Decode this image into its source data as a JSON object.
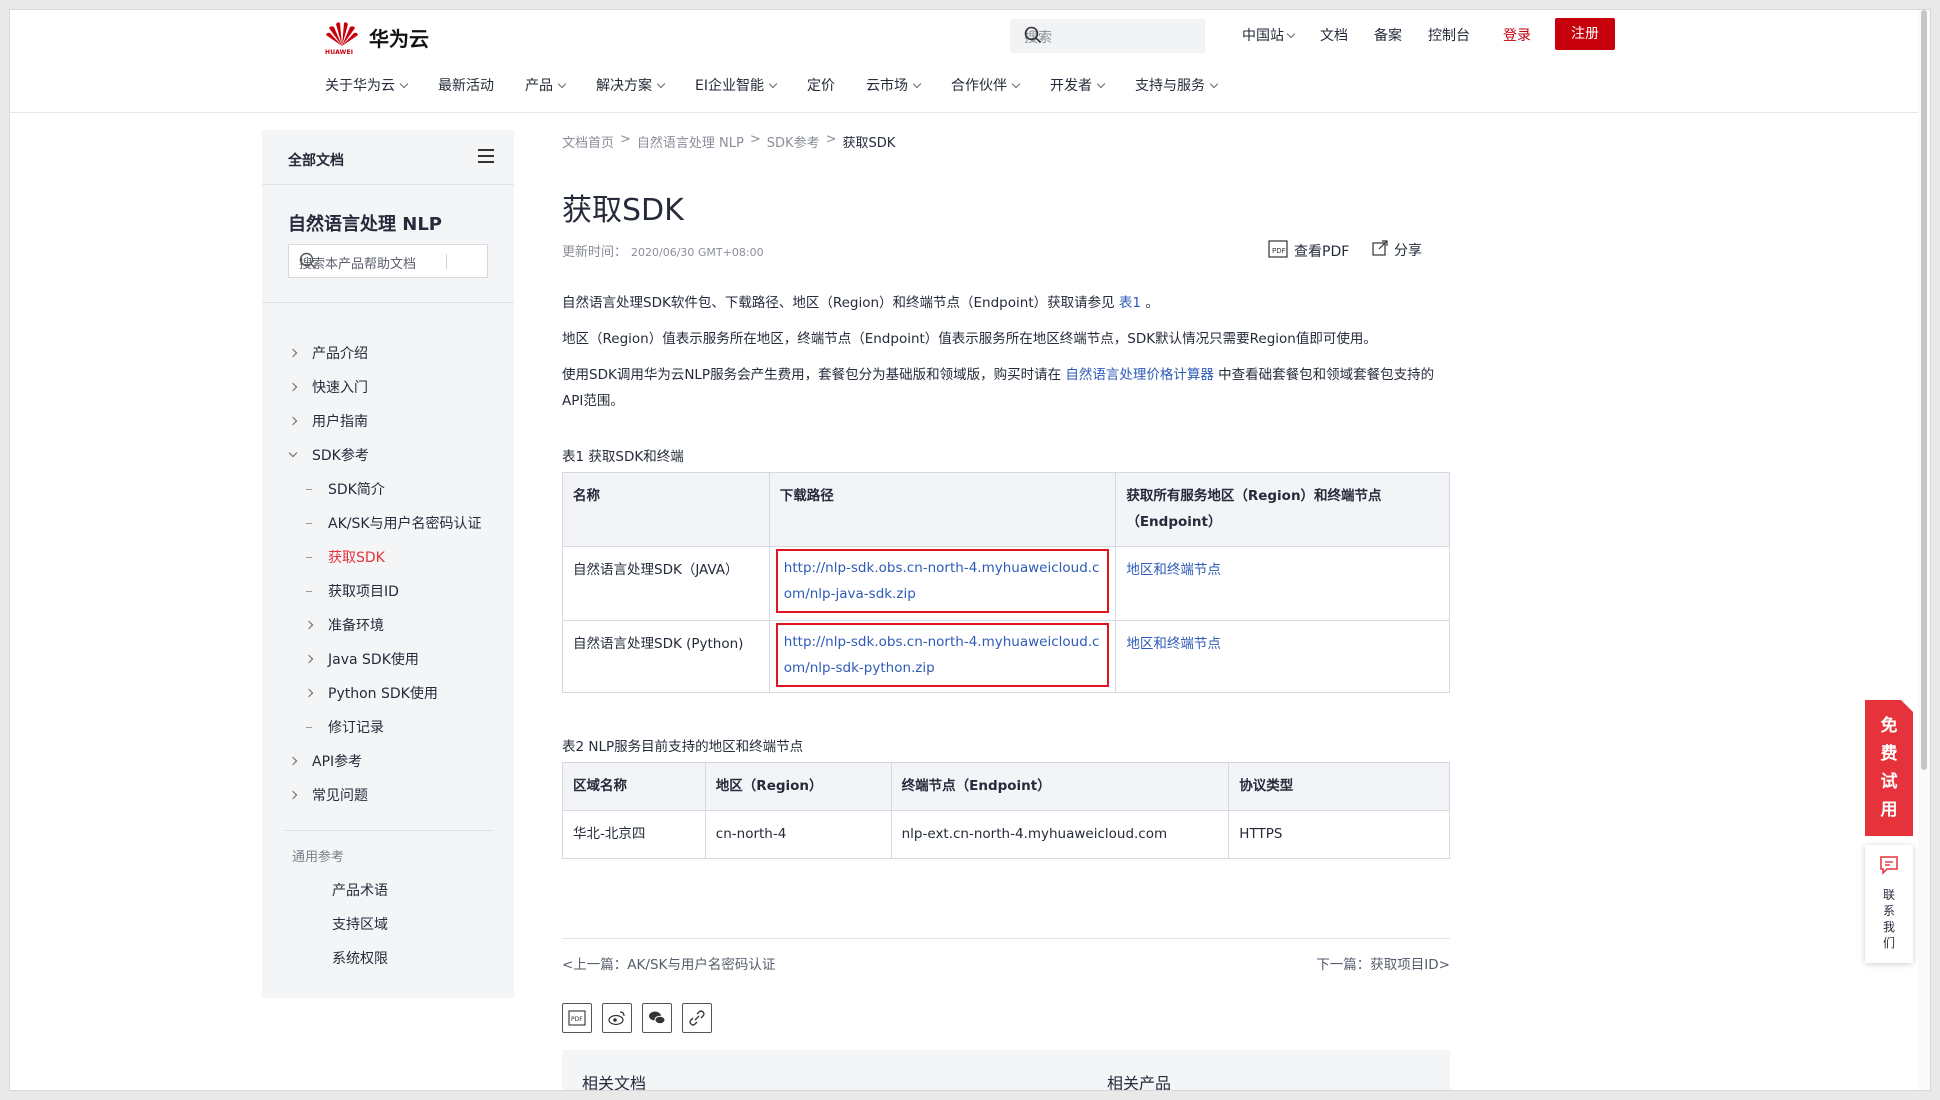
{
  "header": {
    "logo_small": "HUAWEI",
    "logo_text": "华为云",
    "search_placeholder": "搜索",
    "top_links": [
      "中国站",
      "文档",
      "备案",
      "控制台"
    ],
    "login": "登录",
    "register": "注册",
    "main_nav": [
      "关于华为云",
      "最新活动",
      "产品",
      "解决方案",
      "EI企业智能",
      "定价",
      "云市场",
      "合作伙伴",
      "开发者",
      "支持与服务"
    ]
  },
  "sidebar": {
    "all_docs": "全部文档",
    "product": "自然语言处理 NLP",
    "search_placeholder": "搜索本产品帮助文档",
    "tree": [
      {
        "label": "产品介绍",
        "level": 0,
        "marker": "right"
      },
      {
        "label": "快速入门",
        "level": 0,
        "marker": "right"
      },
      {
        "label": "用户指南",
        "level": 0,
        "marker": "right"
      },
      {
        "label": "SDK参考",
        "level": 0,
        "marker": "down"
      },
      {
        "label": "SDK简介",
        "level": 1,
        "marker": "dash"
      },
      {
        "label": "AK/SK与用户名密码认证",
        "level": 1,
        "marker": "dash"
      },
      {
        "label": "获取SDK",
        "level": 1,
        "marker": "dash",
        "active": true
      },
      {
        "label": "获取项目ID",
        "level": 1,
        "marker": "dash"
      },
      {
        "label": "准备环境",
        "level": 1,
        "marker": "right"
      },
      {
        "label": "Java SDK使用",
        "level": 1,
        "marker": "right"
      },
      {
        "label": "Python SDK使用",
        "level": 1,
        "marker": "right"
      },
      {
        "label": "修订记录",
        "level": 1,
        "marker": "dash"
      },
      {
        "label": "API参考",
        "level": 0,
        "marker": "right"
      },
      {
        "label": "常见问题",
        "level": 0,
        "marker": "right"
      }
    ],
    "common_ref": "通用参考",
    "common_items": [
      "产品术语",
      "支持区域",
      "系统权限"
    ]
  },
  "breadcrumb": [
    "文档首页",
    "自然语言处理 NLP",
    "SDK参考",
    "获取SDK"
  ],
  "page": {
    "title": "获取SDK",
    "updated_label": "更新时间：",
    "updated_value": "2020/06/30 GMT+08:00",
    "pdf": "查看PDF",
    "share": "分享",
    "p1_a": "自然语言处理SDK软件包、下载路径、地区（Region）和终端节点（Endpoint）获取请参见",
    "p1_link": "表1",
    "p1_b": "。",
    "p2": "地区（Region）值表示服务所在地区，终端节点（Endpoint）值表示服务所在地区终端节点，SDK默认情况只需要Region值即可使用。",
    "p3_a": "使用SDK调用华为云NLP服务会产生费用，套餐包分为基础版和领域版，购买时请在",
    "p3_link": "自然语言处理价格计算器",
    "p3_b": "中查看础套餐包和领域套餐包支持的API范围。"
  },
  "table1": {
    "caption": "表1 获取SDK和终端",
    "headers": [
      "名称",
      "下载路径",
      "获取所有服务地区（Region）和终端节点（Endpoint）"
    ],
    "rows": [
      [
        "自然语言处理SDK（JAVA）",
        "http://nlp-sdk.obs.cn-north-4.myhuaweicloud.com/nlp-java-sdk.zip",
        "地区和终端节点"
      ],
      [
        "自然语言处理SDK (Python)",
        "http://nlp-sdk.obs.cn-north-4.myhuaweicloud.com/nlp-sdk-python.zip",
        "地区和终端节点"
      ]
    ]
  },
  "table2": {
    "caption": "表2 NLP服务目前支持的地区和终端节点",
    "headers": [
      "区域名称",
      "地区（Region）",
      "终端节点（Endpoint）",
      "协议类型"
    ],
    "rows": [
      [
        "华北-北京四",
        "cn-north-4",
        "nlp-ext.cn-north-4.myhuaweicloud.com",
        "HTTPS"
      ]
    ]
  },
  "pager": {
    "prev": "<上一篇：AK/SK与用户名密码认证",
    "next": "下一篇：获取项目ID>"
  },
  "related": {
    "docs": "相关文档",
    "products": "相关产品"
  },
  "float": {
    "trial": [
      "免",
      "费",
      "试",
      "用"
    ],
    "contact": [
      "联",
      "系",
      "我",
      "们"
    ]
  },
  "colors": {
    "brand_red": "#c7000b",
    "link_blue": "#2e5bb8",
    "active_red": "#e6323b"
  }
}
